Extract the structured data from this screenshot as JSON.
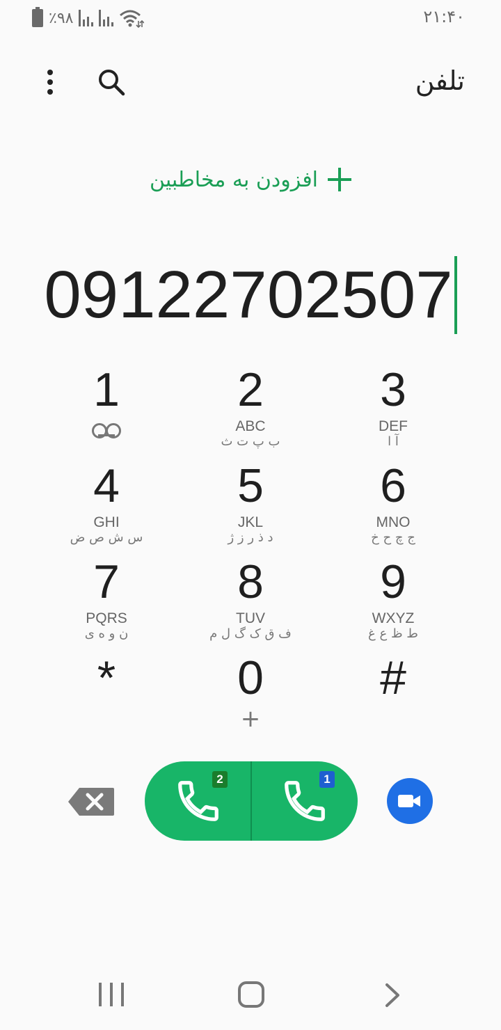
{
  "status_bar": {
    "battery": "٪۹۸",
    "time": "۲۱:۴۰"
  },
  "app_bar": {
    "title": "تلفن"
  },
  "add_contacts": {
    "label": "افزودن به مخاطبین"
  },
  "dialer": {
    "number": "09122702507"
  },
  "keypad": {
    "keys": [
      {
        "digit": "1",
        "letters": "",
        "fa": ""
      },
      {
        "digit": "2",
        "letters": "ABC",
        "fa": "ب پ ت ث"
      },
      {
        "digit": "3",
        "letters": "DEF",
        "fa": "آ ا"
      },
      {
        "digit": "4",
        "letters": "GHI",
        "fa": "س ش ص ض"
      },
      {
        "digit": "5",
        "letters": "JKL",
        "fa": "د ذ ر ز ژ"
      },
      {
        "digit": "6",
        "letters": "MNO",
        "fa": "ج چ ح خ"
      },
      {
        "digit": "7",
        "letters": "PQRS",
        "fa": "ن و ه ی"
      },
      {
        "digit": "8",
        "letters": "TUV",
        "fa": "ف ق ک گ ل م"
      },
      {
        "digit": "9",
        "letters": "WXYZ",
        "fa": "ط ظ ع غ"
      },
      {
        "digit": "*",
        "letters": "",
        "fa": ""
      },
      {
        "digit": "0",
        "letters": "+",
        "fa": ""
      },
      {
        "digit": "#",
        "letters": "",
        "fa": ""
      }
    ]
  },
  "call": {
    "sim2_label": "2",
    "sim1_label": "1"
  },
  "colors": {
    "accent": "#1a9e55",
    "call_button": "#18b568",
    "video_button": "#1f6fe5"
  }
}
